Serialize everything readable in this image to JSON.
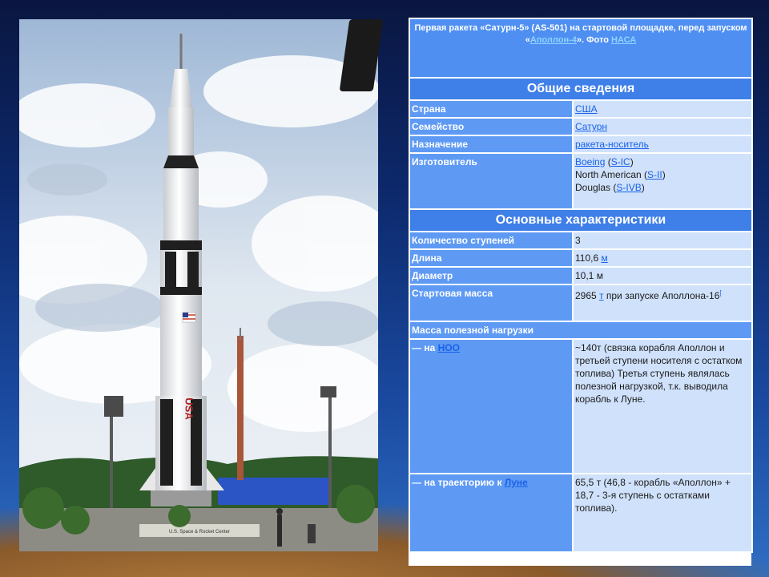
{
  "photo": {
    "flag_text": "USA",
    "sign_text": "U.S. Space & Rocket Center"
  },
  "infobox": {
    "caption_pre": "Первая ракета «Сатурн-5» (AS-501) на стартовой площадке, перед запуском «",
    "caption_link1": "Аполлон-4",
    "caption_mid": "». Фото ",
    "caption_link2": "НАСА",
    "section1": "Общие сведения",
    "country_label": "Страна",
    "country_value": "США",
    "family_label": "Семейство",
    "family_value": "Сатурн",
    "purpose_label": "Назначение",
    "purpose_value": "ракета-носитель",
    "maker_label": "Изготовитель",
    "maker_line1_link": "Boeing",
    "maker_line1_sp": " (",
    "maker_line1_stage": "S-IC",
    "maker_line1_close": ")",
    "maker_line2_text": "North American (",
    "maker_line2_stage": "S-II",
    "maker_line2_close": ")",
    "maker_line3_text": "Douglas (",
    "maker_line3_stage": "S-IVB",
    "maker_line3_close": ")",
    "section2": "Основные характеристики",
    "stages_label": "Количество ступеней",
    "stages_value": "3",
    "length_label": "Длина",
    "length_value": "110,6 ",
    "length_unit": "м",
    "diameter_label": "Диаметр",
    "diameter_value": "10,1 м",
    "mass_label": "Стартовая масса",
    "mass_value": "2965 ",
    "mass_unit": "т",
    "mass_rest": " при запуске Аполлона-16",
    "mass_note": "[",
    "payload_label": "Масса полезной нагрузки",
    "leo_prefix": "— на ",
    "leo_link": "НОО",
    "leo_value": "~140т (связка корабля Аполлон и третьей ступени носителя с остатком топлива) Третья ступень являлась полезной нагрузкой, т.к. выводила корабль к Луне.",
    "moon_prefix": "— на траекторию к ",
    "moon_link": "Луне",
    "moon_value": "65,5 т (46,8 - корабль «Аполлон» + 18,7 - 3-я ступень с остатками топлива)."
  }
}
